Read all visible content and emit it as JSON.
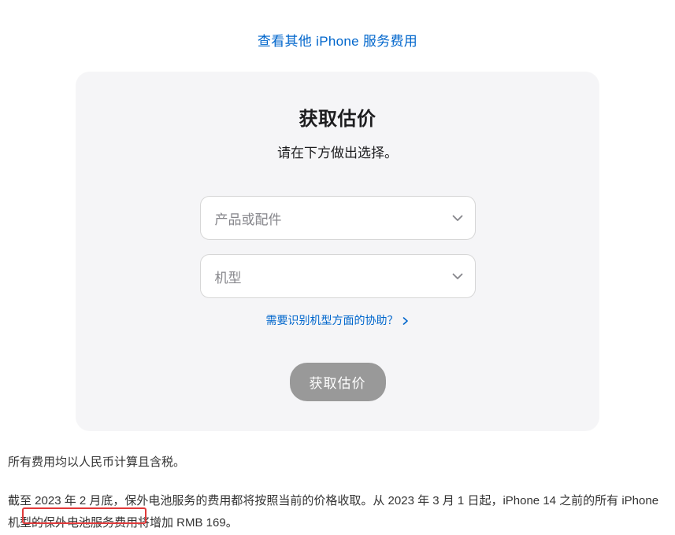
{
  "topLink": {
    "label": "查看其他 iPhone 服务费用"
  },
  "card": {
    "title": "获取估价",
    "subtitle": "请在下方做出选择。",
    "select1": {
      "placeholder": "产品或配件"
    },
    "select2": {
      "placeholder": "机型"
    },
    "helpLink": {
      "label": "需要识别机型方面的协助？"
    },
    "submit": {
      "label": "获取估价"
    }
  },
  "footer": {
    "line1": "所有费用均以人民币计算且含税。",
    "line2": "截至 2023 年 2 月底，保外电池服务的费用都将按照当前的价格收取。从 2023 年 3 月 1 日起，iPhone 14 之前的所有 iPhone 机型的保外电池服务费用将增加 RMB 169。"
  }
}
